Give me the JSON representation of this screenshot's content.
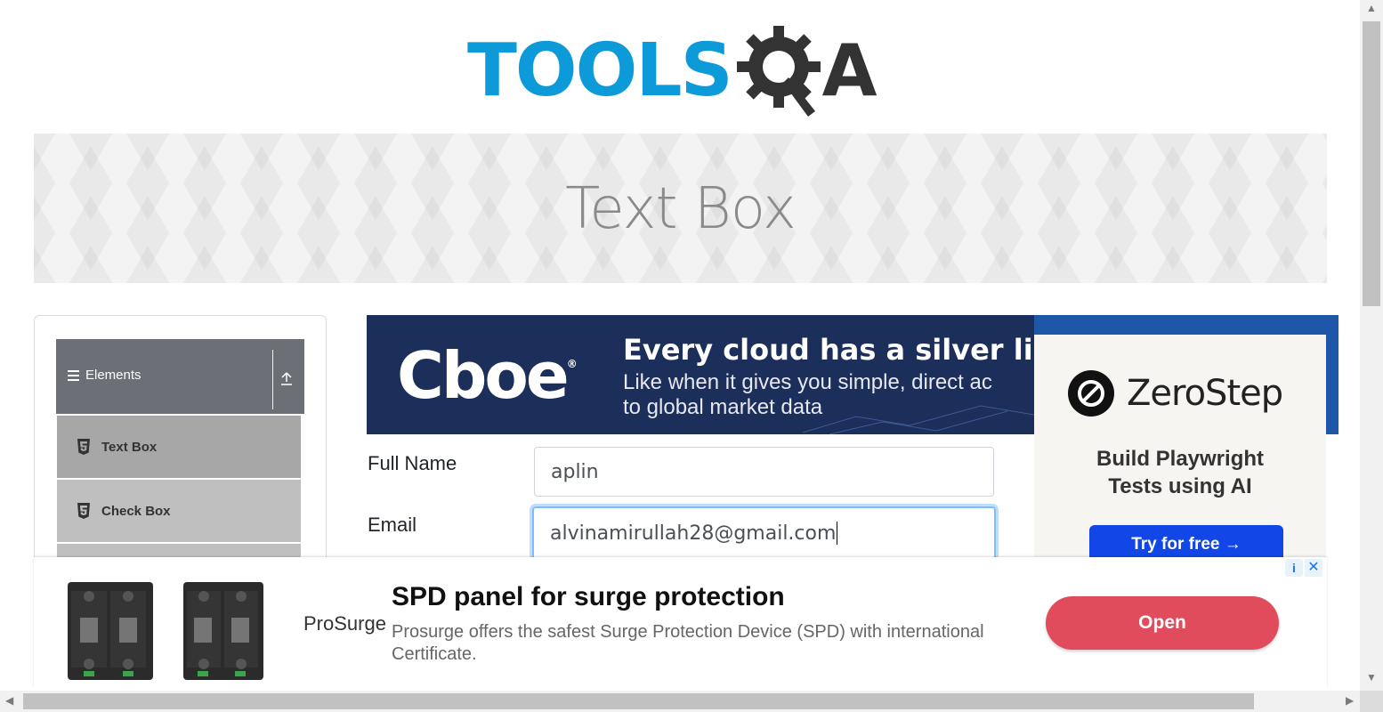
{
  "header": {
    "logo_text_left": "TOOLS",
    "logo_text_right": "A"
  },
  "banner": {
    "title": "Text Box"
  },
  "sidebar": {
    "group_label": "Elements",
    "items": [
      {
        "label": "Text Box",
        "active": true
      },
      {
        "label": "Check Box",
        "active": false
      }
    ]
  },
  "ads": {
    "cboe": {
      "brand": "Cboe",
      "headline": "Every cloud has a silver lin",
      "subline1": "Like when it gives you simple, direct ac",
      "subline2": "to global market data"
    },
    "zerostep": {
      "brand": "ZeroStep",
      "tagline1": "Build Playwright",
      "tagline2": "Tests using AI",
      "cta": "Try for free →"
    },
    "bottom": {
      "brand": "ProSurge",
      "title": "SPD panel for surge protection",
      "description": "Prosurge offers the safest Surge Protection Device (SPD) with international Certificate.",
      "cta": "Open"
    }
  },
  "form": {
    "full_name_label": "Full Name",
    "full_name_value": "aplin",
    "email_label": "Email",
    "email_value": "alvinamirullah28@gmail.com"
  },
  "colors": {
    "brand_blue": "#0d9ad8",
    "nav_header": "#6b7077",
    "nav_active": "#a7a7a7",
    "ad_open_button": "#e14c5d",
    "focus_border": "#80bdff"
  }
}
